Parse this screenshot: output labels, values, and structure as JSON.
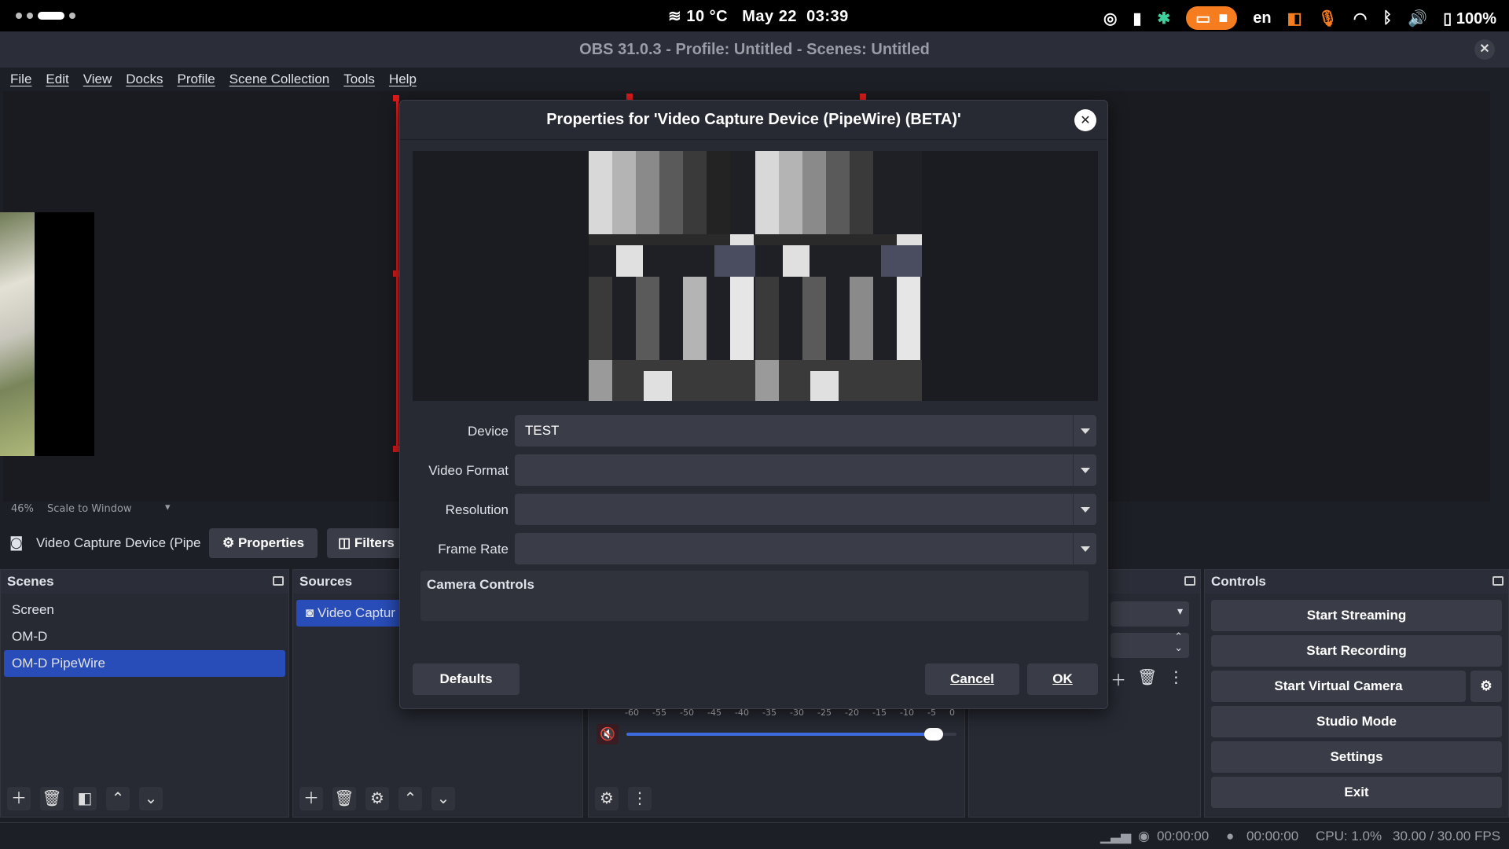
{
  "sysbar": {
    "weather": "10 °C",
    "date": "May 22",
    "time": "03:39",
    "lang": "en",
    "battery": "100%"
  },
  "window": {
    "title": "OBS 31.0.3 - Profile: Untitled - Scenes: Untitled"
  },
  "menu": [
    "File",
    "Edit",
    "View",
    "Docks",
    "Profile",
    "Scene Collection",
    "Tools",
    "Help"
  ],
  "preview": {
    "zoom": "46%",
    "scale_mode": "Scale to Window"
  },
  "source_toolbar": {
    "source_name": "Video Capture Device (Pipe",
    "properties_label": "Properties",
    "filters_label": "Filters"
  },
  "scenes": {
    "title": "Scenes",
    "items": [
      "Screen",
      "OM-D",
      "OM-D PipeWire"
    ],
    "selected": "OM-D PipeWire"
  },
  "sources": {
    "title": "Sources",
    "items": [
      "Video Captur"
    ]
  },
  "mixer": {
    "ticks": [
      "-60",
      "-55",
      "-50",
      "-45",
      "-40",
      "-35",
      "-30",
      "-25",
      "-20",
      "-15",
      "-10",
      "-5",
      "0"
    ],
    "volume_fraction": 0.93
  },
  "controls": {
    "title": "Controls",
    "start_streaming": "Start Streaming",
    "start_recording": "Start Recording",
    "start_virtual_camera": "Start Virtual Camera",
    "studio_mode": "Studio Mode",
    "settings": "Settings",
    "exit": "Exit"
  },
  "dialog": {
    "title": "Properties for 'Video Capture Device (PipeWire) (BETA)'",
    "device_label": "Device",
    "device_value": "TEST",
    "video_format_label": "Video Format",
    "video_format_value": "",
    "resolution_label": "Resolution",
    "resolution_value": "",
    "frame_rate_label": "Frame Rate",
    "frame_rate_value": "",
    "camera_controls_label": "Camera Controls",
    "defaults_label": "Defaults",
    "cancel_label": "Cancel",
    "ok_label": "OK"
  },
  "status": {
    "stream_time": "00:00:00",
    "rec_time": "00:00:00",
    "cpu": "CPU: 1.0%",
    "fps": "30.00 / 30.00 FPS"
  },
  "colors": {
    "accent": "#284cb8",
    "selection_red": "#e01b1b",
    "orange_pill": "#f57c1f"
  }
}
